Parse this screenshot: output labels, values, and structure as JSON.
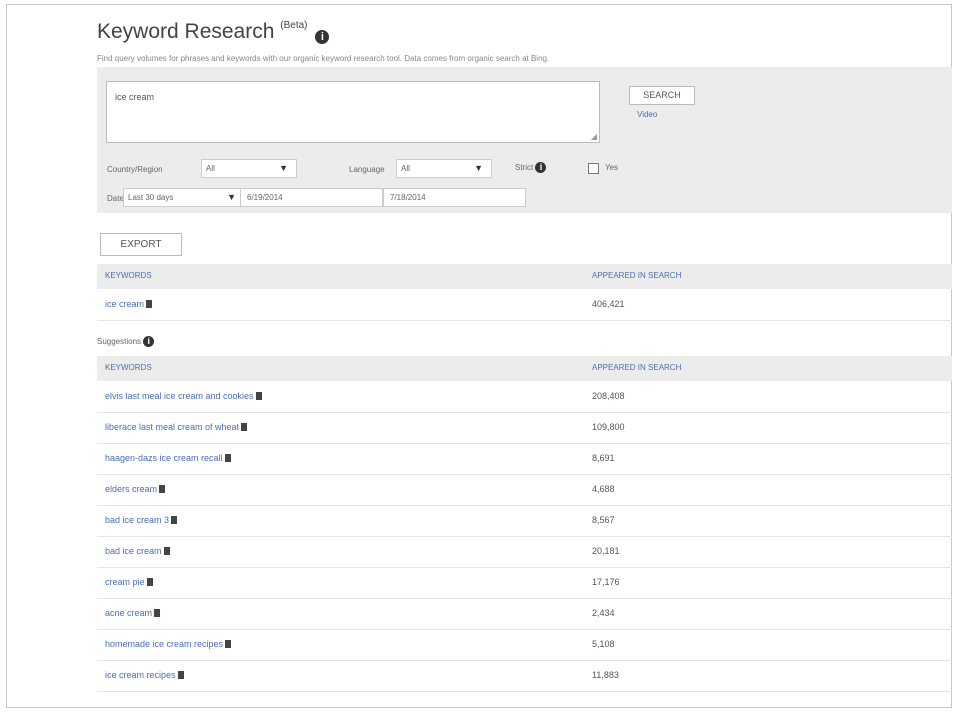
{
  "header": {
    "title": "Keyword Research",
    "beta": "(Beta)",
    "subtitle": "Find query volumes for phrases and keywords with our organic keyword research tool. Data comes from organic search at Bing."
  },
  "search": {
    "query": "ice cream",
    "button": "SEARCH",
    "video_link": "Video"
  },
  "filters": {
    "country_label": "Country/Region",
    "country_value": "All",
    "language_label": "Language",
    "language_value": "All",
    "strict_label": "Strict",
    "strict_yes": "Yes",
    "date_label": "Date",
    "date_range": "Last 30 days",
    "date_from": "6/19/2014",
    "date_to": "7/18/2014"
  },
  "export_label": "EXPORT",
  "columns": {
    "keyword": "KEYWORDS",
    "appeared": "APPEARED IN SEARCH"
  },
  "primary": {
    "keyword": "ice cream",
    "count": "406,421"
  },
  "suggestions_label": "Suggestions",
  "suggestions": [
    {
      "keyword": "elvis last meal ice cream and cookies",
      "count": "208,408"
    },
    {
      "keyword": "liberace last meal cream of wheat",
      "count": "109,800"
    },
    {
      "keyword": "haagen-dazs ice cream recall",
      "count": "8,691"
    },
    {
      "keyword": "elders cream",
      "count": "4,688"
    },
    {
      "keyword": "bad ice cream 3",
      "count": "8,567"
    },
    {
      "keyword": "bad ice cream",
      "count": "20,181"
    },
    {
      "keyword": "cream pie",
      "count": "17,176"
    },
    {
      "keyword": "acne cream",
      "count": "2,434"
    },
    {
      "keyword": "homemade ice cream recipes",
      "count": "5,108"
    },
    {
      "keyword": "ice cream recipes",
      "count": "11,883"
    }
  ]
}
